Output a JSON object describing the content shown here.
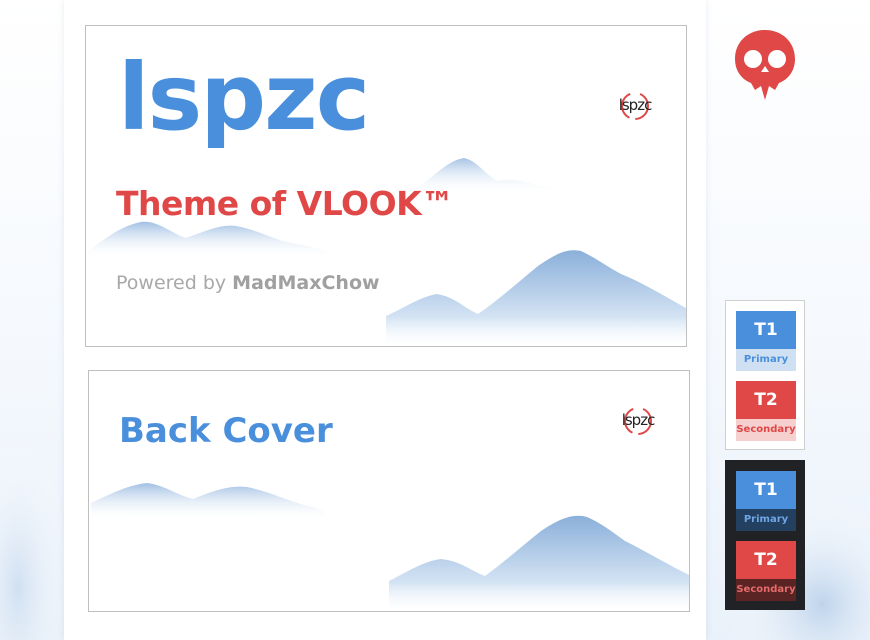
{
  "cover": {
    "title": "lspzc",
    "subtitle": "Theme of VLOOK™",
    "powered_prefix": "Powered by",
    "powered_author": "MadMaxChow",
    "logo_text": "lspzc"
  },
  "back_cover": {
    "title": "Back Cover",
    "logo_text": "lspzc"
  },
  "swatches": {
    "light": [
      {
        "label": "T1",
        "sub": "Primary"
      },
      {
        "label": "T2",
        "sub": "Secondary"
      }
    ],
    "dark": [
      {
        "label": "T1",
        "sub": "Primary"
      },
      {
        "label": "T2",
        "sub": "Secondary"
      }
    ]
  },
  "colors": {
    "primary": "#4a8fdc",
    "secondary": "#e04848",
    "dark_panel": "#202226",
    "mountain": "#a9c6e6"
  },
  "icons": [
    "skull-logo-icon",
    "lspzc-logo-icon",
    "mountain-illustration"
  ]
}
